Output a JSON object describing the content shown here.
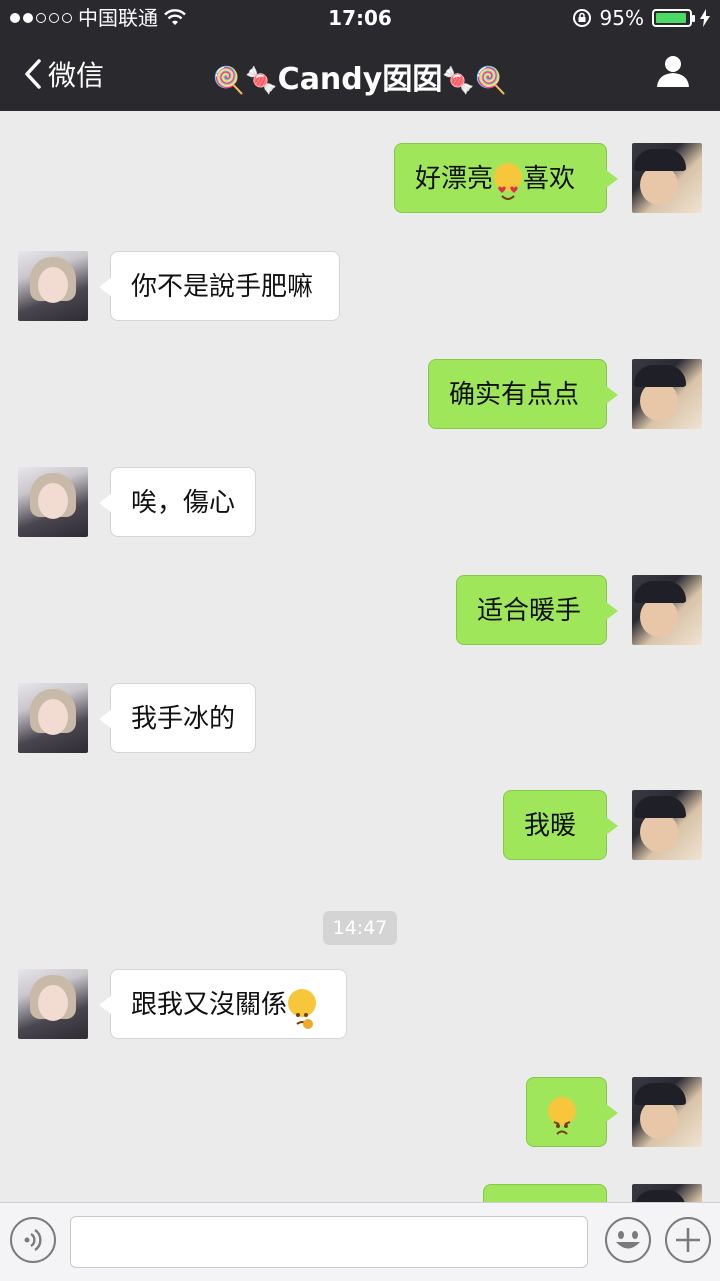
{
  "status_bar": {
    "carrier": "中国联通",
    "time": "17:06",
    "battery": "95%",
    "battery_level": 0.95
  },
  "nav": {
    "back_label": "微信",
    "title": "Candy囡囡",
    "title_emoji_left": "🍭🍬",
    "title_emoji_right": "🍬🍭"
  },
  "messages": [
    {
      "sender": "me",
      "text": "好漂亮",
      "emoji": "heart-eyes-emoji",
      "text_after": "喜欢"
    },
    {
      "sender": "her",
      "text": "你不是說手肥嘛"
    },
    {
      "sender": "me",
      "text": "确实有点点"
    },
    {
      "sender": "her",
      "text": "唉，傷心"
    },
    {
      "sender": "me",
      "text": "适合暖手"
    },
    {
      "sender": "her",
      "text": "我手冰的"
    },
    {
      "sender": "me",
      "text": "我暖"
    },
    {
      "sender": "her",
      "text": "跟我又沒關係",
      "emoji": "thinking-emoji"
    },
    {
      "sender": "me",
      "text": "",
      "emoji": "worried-emoji"
    }
  ],
  "timestamp": "14:47",
  "colors": {
    "nav_bg": "#2a2a2e",
    "my_bubble": "#9fe65a",
    "her_bubble": "#ffffff",
    "chat_bg": "#ebebeb"
  }
}
